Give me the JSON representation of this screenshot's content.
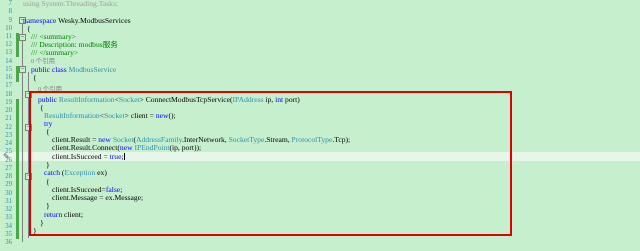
{
  "editor": {
    "line_numbers": [
      "7",
      "8",
      "9",
      "10",
      "11",
      "12",
      "13",
      "14",
      "15",
      "16",
      "17",
      "18",
      "19",
      "20",
      "21",
      "22",
      "23",
      "24",
      "25",
      "26",
      "27",
      "28",
      "29",
      "30",
      "31",
      "32",
      "33",
      "34",
      "35",
      "36"
    ],
    "lines": {
      "l1": "using System.Threading.Tasks;",
      "l3_kw": "namespace",
      "l3_rest": " Wesky.ModbusServices",
      "l4": "{",
      "l5": "/// <summary>",
      "l6": "/// Description: modbus服务",
      "l7": "/// </summary>",
      "l8_refs": "0 个引用",
      "l9_kw1": "public",
      "l9_kw2": "class",
      "l9_type": "ModbusService",
      "l10": "{",
      "l11_refs": "0 个引用",
      "l12_public": "public",
      "l12_type1": "ResultInformation",
      "l12_lt": "<",
      "l12_type2": "Socket",
      "l12_gt": ">",
      "l12_name": " ConnectModbusTcpService(",
      "l12_type3": "IPAddress",
      "l12_p1": " ip, ",
      "l12_int": "int",
      "l12_p2": " port)",
      "l13": "{",
      "l14_type1": "ResultInformation",
      "l14_lt": "<",
      "l14_type2": "Socket",
      "l14_gt": ">",
      "l14_mid": " client = ",
      "l14_new": "new",
      "l14_end": "();",
      "l15": "try",
      "l16": "{",
      "l17_a": "client.Result = ",
      "l17_new": "new",
      "l17_sp": " ",
      "l17_type1": "Socket",
      "l17_b": "(",
      "l17_type2": "AddressFamily",
      "l17_c": ".InterNetwork, ",
      "l17_type3": "SocketType",
      "l17_d": ".Stream, ",
      "l17_type4": "ProtocolType",
      "l17_e": ".Tcp);",
      "l18_a": "client.Result.Connect(",
      "l18_new": "new",
      "l18_sp": " ",
      "l18_type": "IPEndPoint",
      "l18_b": "(ip, port));",
      "l19_a": "client.IsSucceed = ",
      "l19_true": "true",
      "l19_end": ";",
      "l20": "}",
      "l21_catch": "catch",
      "l21_a": " (",
      "l21_type": "Exception",
      "l21_b": " ex)",
      "l22": "{",
      "l23_a": "client.IsSucceed=",
      "l23_false": "false",
      "l23_end": ";",
      "l24": "client.Message = ex.Message;",
      "l25": "}",
      "l26_return": "return",
      "l26_rest": " client;",
      "l27": "}",
      "l28": "}"
    }
  },
  "colors": {
    "background": "#c6efce",
    "keyword": "#0000ff",
    "type": "#2b91af",
    "comment": "#008000",
    "highlight_box": "#e00000",
    "change_bar": "#4aa84a"
  },
  "icons": {
    "fold_minus": "−",
    "edit_pencil": "✎"
  }
}
